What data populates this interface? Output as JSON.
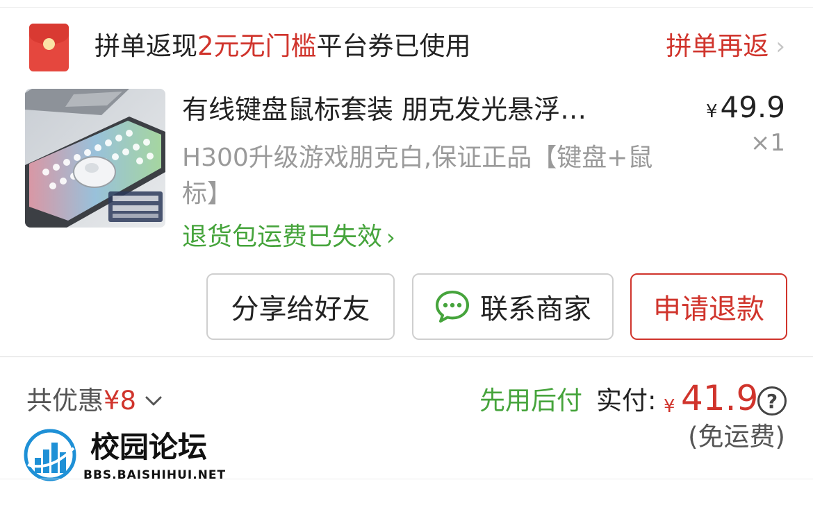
{
  "promo": {
    "text_before": "拼单返现",
    "text_highlight": "2元无门槛",
    "text_after": "平台券已使用",
    "link_label": "拼单再返",
    "chevron": "›"
  },
  "product": {
    "title": "有线键盘鼠标套装 朋克发光悬浮…",
    "spec": "H300升级游戏朋克白,保证正品【键盘+鼠标】",
    "return_notice": "退货包运费已失效",
    "return_chevron": "›",
    "price_symbol": "¥",
    "price": "49.9",
    "quantity": "×1",
    "thumbnail_icon": "keyboard-mouse-photo"
  },
  "buttons": {
    "share": "分享给好友",
    "contact": "联系商家",
    "refund": "申请退款"
  },
  "summary": {
    "discount_label": "共优惠",
    "discount_amount": "¥8",
    "pay_later": "先用后付",
    "paid_label": "实付:",
    "paid_symbol": "¥",
    "paid_amount": "41.9",
    "help": "?",
    "shipping_note": "(免运费)"
  },
  "watermark": {
    "title": "校园论坛",
    "url": "BBS.BAISHIHUI.NET"
  },
  "colors": {
    "accent_red": "#d0342c",
    "accent_green": "#46a43c",
    "muted_gray": "#9a9a9a"
  }
}
